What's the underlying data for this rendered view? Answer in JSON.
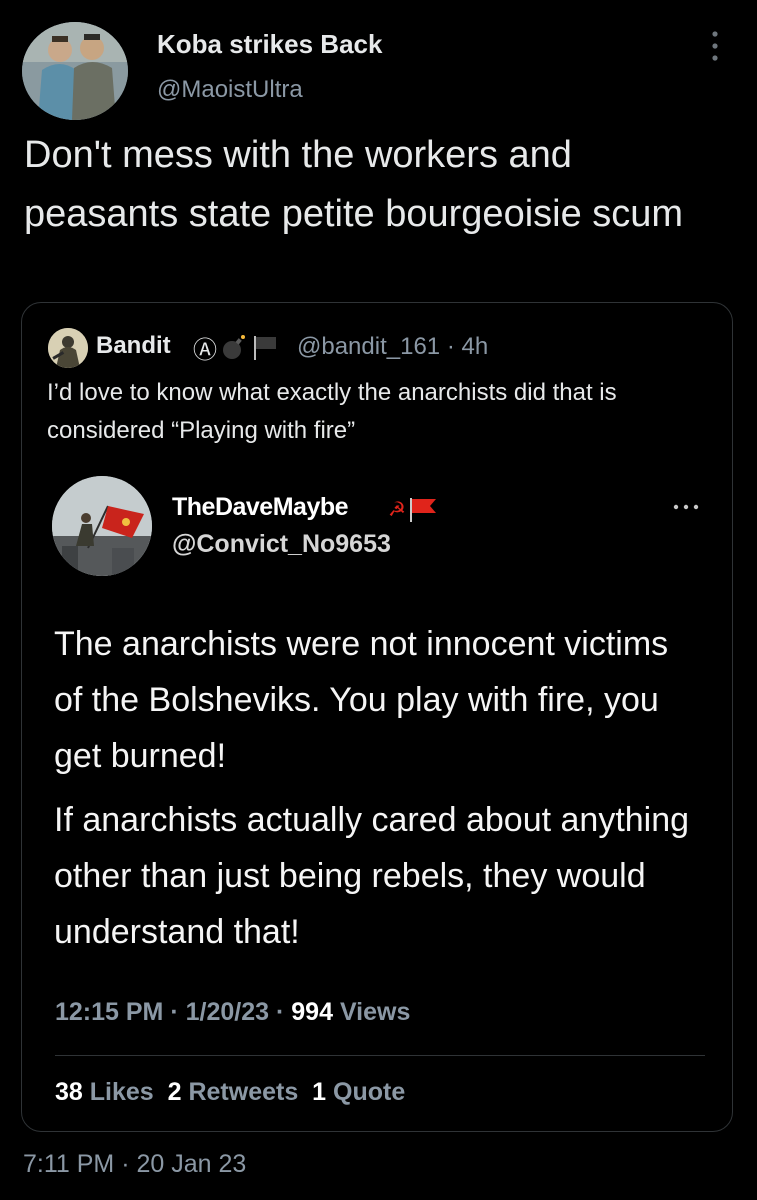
{
  "outer_tweet": {
    "display_name": "Koba strikes Back",
    "handle": "@MaoistUltra",
    "text": "Don't mess with the workers and peasants state petite bourgeoisie scum",
    "timestamp": "7:11 PM · 20 Jan 23",
    "more_icon": "more-vertical-icon"
  },
  "quoted_tweet": {
    "display_name": "Bandit",
    "badges": "Ⓐ",
    "handle": "@bandit_161",
    "sep": "·",
    "age": "4h",
    "text": "I’d love to know what exactly the anarchists did that is considered “Playing with fire”"
  },
  "embedded_tweet": {
    "display_name": "TheDaveMaybe",
    "flag_text": "☭",
    "handle": "@Convict_No9653",
    "more_icon": "more-horizontal-icon",
    "paragraph_1": "The anarchists were not innocent victims of the Bolsheviks. You play with fire, you get burned!",
    "paragraph_2": "If anarchists actually cared about anything other than just being rebels, they would understand that!",
    "time": "12:15 PM",
    "date": "1/20/23",
    "views_count": "994",
    "views_label": "Views",
    "likes_count": "38",
    "likes_label": "Likes",
    "retweets_count": "2",
    "retweets_label": "Retweets",
    "quotes_count": "1",
    "quotes_label": "Quote",
    "dot": "·"
  },
  "colors": {
    "background": "#000000",
    "text_primary": "#e7e9ea",
    "text_secondary": "#8b98a5",
    "border": "#2f3336",
    "flag_red": "#e0241b"
  }
}
